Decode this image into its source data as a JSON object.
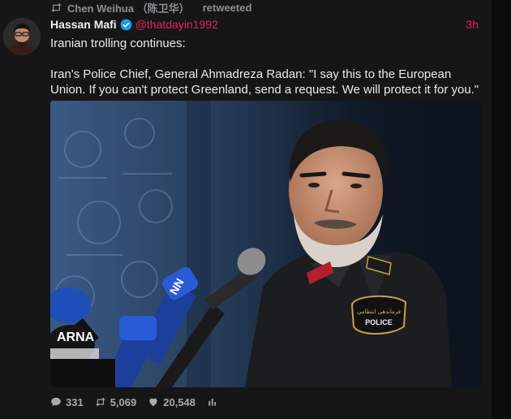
{
  "retweet": {
    "user": "Chen Weihua （陈卫华）",
    "label": "retweeted",
    "icon": "retweet-icon"
  },
  "tweet": {
    "name": "Hassan Mafi",
    "handle": "@thatdayin1992",
    "time": "3h",
    "verified": true,
    "paragraphs": [
      "Iranian trolling continues:",
      "Iran's Police Chief, General Ahmadreza Radan: \"I say this to the European Union. If you can't protect Greenland, send a request. We will protect it for you.\""
    ]
  },
  "media": {
    "mic_labels": [
      "NN",
      "ARNA"
    ],
    "badge_text": "POLICE",
    "badge_script": "فرماندهی انتظامی"
  },
  "actions": {
    "replies": "331",
    "retweets": "5,069",
    "likes": "20,548"
  },
  "colors": {
    "accent": "#e0245e",
    "verified": "#1d9bf0",
    "background": "#161616"
  }
}
